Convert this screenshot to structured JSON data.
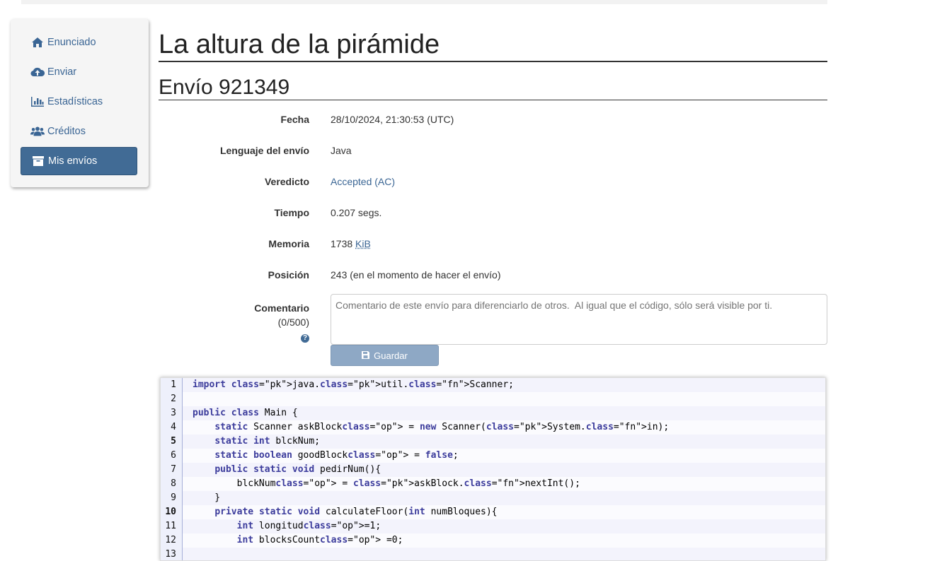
{
  "sidebar": {
    "items": [
      {
        "label": "Enunciado",
        "icon": "home-icon",
        "active": false
      },
      {
        "label": "Enviar",
        "icon": "cloud-upload-icon",
        "active": false
      },
      {
        "label": "Estadísticas",
        "icon": "bar-chart-icon",
        "active": false
      },
      {
        "label": "Créditos",
        "icon": "users-icon",
        "active": false
      },
      {
        "label": "Mis envíos",
        "icon": "archive-icon",
        "active": true
      }
    ]
  },
  "page": {
    "title": "La altura de la pirámide",
    "subtitle": "Envío 921349"
  },
  "details": {
    "fecha_label": "Fecha",
    "fecha_value": "28/10/2024, 21:30:53 (UTC)",
    "lenguaje_label": "Lenguaje del envío",
    "lenguaje_value": "Java",
    "veredicto_label": "Veredicto",
    "veredicto_value": "Accepted (AC)",
    "tiempo_label": "Tiempo",
    "tiempo_value": "0.207 segs.",
    "memoria_label": "Memoria",
    "memoria_value": "1738",
    "memoria_unit": "KiB",
    "posicion_label": "Posición",
    "posicion_value": "243 (en el momento de hacer el envío)"
  },
  "comment": {
    "label": "Comentario",
    "counter": "(0/500)",
    "help": "?",
    "placeholder": "Comentario de este envío para diferenciarlo de otros.  Al igual que el código, sólo será visible por ti.",
    "save_label": "Guardar"
  },
  "code": {
    "line_numbers": [
      "1",
      "2",
      "3",
      "4",
      "5",
      "6",
      "7",
      "8",
      "9",
      "10",
      "11",
      "12",
      "13"
    ],
    "lines": [
      "import java.util.Scanner;",
      "",
      "public class Main {",
      "    static Scanner askBlock = new Scanner(System.in);",
      "    static int blckNum;",
      "    static boolean goodBlock = false;",
      "    public static void pedirNum(){",
      "        blckNum = askBlock.nextInt();",
      "    }",
      "    private static void calculateFloor(int numBloques){",
      "        int longitud=1;",
      "        int blocksCount =0;",
      ""
    ]
  },
  "colors": {
    "accent": "#416b95",
    "link": "#3a6594",
    "save_button": "#8ea8c5"
  }
}
